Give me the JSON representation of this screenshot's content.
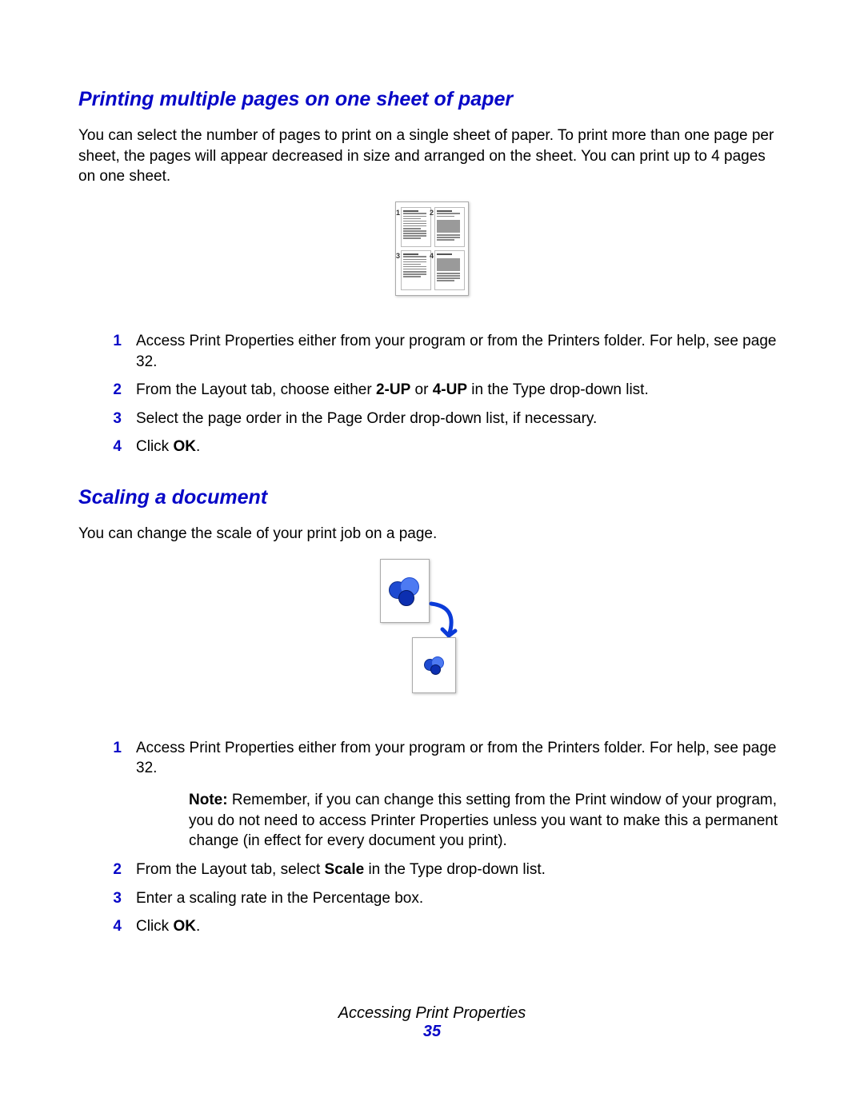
{
  "section1": {
    "heading": "Printing multiple pages on one sheet of paper",
    "intro": "You can select the number of pages to print on a single sheet of paper. To print more than one page per sheet, the pages will appear decreased in size and arranged on the sheet. You can print up to 4 pages on one sheet.",
    "steps": [
      {
        "num": "1",
        "pre": "Access Print Properties either from your program or from the Printers folder. For help, see page 32."
      },
      {
        "num": "2",
        "pre": "From the Layout tab, choose either ",
        "b1": "2-UP",
        "mid": " or ",
        "b2": "4-UP",
        "post": " in the Type drop-down list."
      },
      {
        "num": "3",
        "pre": "Select the page order in the Page Order drop-down list, if necessary."
      },
      {
        "num": "4",
        "pre": "Click ",
        "b1": "OK",
        "post": "."
      }
    ]
  },
  "section2": {
    "heading": "Scaling a document",
    "intro": "You can change the scale of your print job on a page.",
    "steps": [
      {
        "num": "1",
        "pre": "Access Print Properties either from your program or from the Printers folder. For help, see page 32."
      },
      {
        "num": "2",
        "pre": "From the Layout tab, select ",
        "b1": "Scale",
        "post": " in the Type drop-down list."
      },
      {
        "num": "3",
        "pre": "Enter a scaling rate in the Percentage box."
      },
      {
        "num": "4",
        "pre": "Click ",
        "b1": "OK",
        "post": "."
      }
    ],
    "note": {
      "label": "Note:",
      "text": " Remember, if you can change this setting from the Print window of your program, you do not need to access Printer Properties unless you want to make this a permanent change (in effect for every document you print)."
    }
  },
  "footer": {
    "title": "Accessing Print Properties",
    "page": "35"
  },
  "figure1_cells": [
    "1",
    "2",
    "3",
    "4"
  ]
}
